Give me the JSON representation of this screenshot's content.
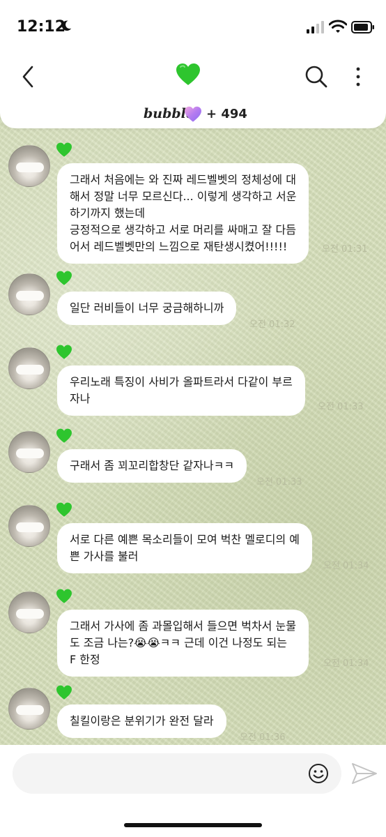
{
  "status_bar": {
    "time": "12:12"
  },
  "header": {
    "title_icon": "green-heart-icon"
  },
  "bubble_bar": {
    "brand": "bubble",
    "heart_icon": "purple-heart-icon",
    "count": "+ 494"
  },
  "colors": {
    "chat_background": "#d6dfba",
    "bubble": "#ffffff",
    "green_heart": "#2ec52e",
    "timestamp": "#b8bd9f"
  },
  "messages": [
    {
      "text": "그래서 처음에는 와 진짜 레드벨벳의 정체성에 대\n해서 정말 너무 모르신다... 이렇게 생각하고 서운\n하기까지 했는데\n긍정적으로 생각하고 서로 머리를 싸매고 잘 다듬\n어서 레드벨벳만의 느낌으로 재탄생시켰어!!!!!",
      "time": "오전 01:31"
    },
    {
      "text": "일단 러비들이 너무 궁금해하니까",
      "time": "오전 01:32"
    },
    {
      "text": "우리노래 특징이 사비가 올파트라서 다같이 부르\n자나",
      "time": "오전 01:33"
    },
    {
      "text": "구래서 좀 꾀꼬리합창단 같자나ㅋㅋ",
      "time": "오전 01:33"
    },
    {
      "text": "서로 다른 예쁜 목소리들이 모여 벅찬 멜로디의 예\n쁜 가사를 불러",
      "time": "오전 01:34"
    },
    {
      "text": "그래서 가사에 좀 과몰입해서 들으면 벅차서 눈물\n도 조금 나는?😭😭ㅋㅋ 근데 이건 나정도 되는\nF 한정",
      "time": "오전 01:34"
    },
    {
      "text": "칠킬이랑은 분위기가 완전 달라",
      "time": "오전 01:36"
    }
  ],
  "input": {
    "placeholder": ""
  }
}
